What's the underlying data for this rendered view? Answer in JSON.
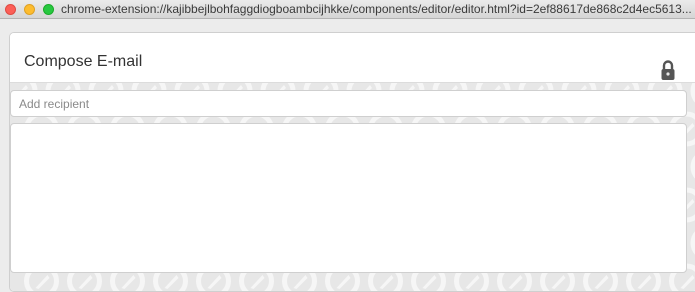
{
  "window": {
    "url": "chrome-extension://kajibbejlbohfaggdiogboambcijhkke/components/editor/editor.html?id=2ef88617de868c2d4ec5613..."
  },
  "compose": {
    "title": "Compose E-mail",
    "recipient_placeholder": "Add recipient",
    "recipient_value": "",
    "body_value": "",
    "lock_icon": "padlock-icon"
  },
  "colors": {
    "pattern_bg": "#e7e7e7",
    "pattern_mark": "#f6f6f6",
    "lock": "#555555"
  }
}
